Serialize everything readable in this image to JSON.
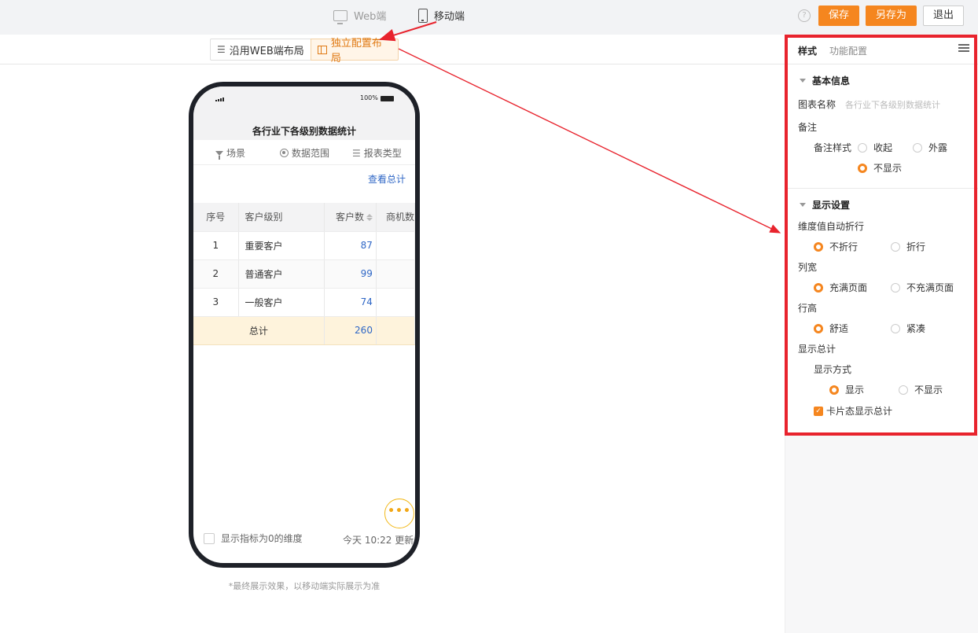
{
  "topbar": {
    "platforms": [
      {
        "label": "Web端",
        "active": false,
        "icon": "monitor-icon"
      },
      {
        "label": "移动端",
        "active": true,
        "icon": "phone-icon"
      }
    ],
    "help_glyph": "?",
    "buttons": {
      "save": "保存",
      "save_as": "另存为",
      "exit": "退出"
    }
  },
  "layout_toggle": {
    "inherit_label": "沿用WEB端布局",
    "independent_label": "独立配置布局",
    "selected": "independent"
  },
  "phone": {
    "battery": "100%",
    "title": "各行业下各级别数据统计",
    "filters": [
      {
        "label": "场景",
        "icon": "funnel-icon"
      },
      {
        "label": "数据范围",
        "icon": "target-icon"
      },
      {
        "label": "报表类型",
        "icon": "list-icon"
      }
    ],
    "view_total": "查看总计",
    "table": {
      "headers": [
        "序号",
        "客户级别",
        "客户数",
        "商机数"
      ],
      "rows": [
        {
          "idx": "1",
          "level": "重要客户",
          "count": "87"
        },
        {
          "idx": "2",
          "level": "普通客户",
          "count": "99"
        },
        {
          "idx": "3",
          "level": "一般客户",
          "count": "74"
        }
      ],
      "total": {
        "label": "总计",
        "count": "260"
      }
    },
    "more_glyph": "•••",
    "zero_dimension_label": "显示指标为0的维度",
    "updated_text": "今天 10:22 更新"
  },
  "disclaimer": "*最终展示效果，以移动端实际展示为准",
  "panel": {
    "tabs": [
      "样式",
      "功能配置"
    ],
    "basic_info": {
      "title": "基本信息",
      "chart_name_label": "图表名称",
      "chart_name_placeholder": "各行业下各级别数据统计",
      "remark_label": "备注",
      "remark_style_label": "备注样式",
      "remark_options": [
        "收起",
        "外露",
        "不显示"
      ],
      "remark_selected": "不显示"
    },
    "display": {
      "title": "显示设置",
      "wrap_label": "维度值自动折行",
      "wrap_options": [
        "不折行",
        "折行"
      ],
      "width_label": "列宽",
      "width_options": [
        "充满页面",
        "不充满页面"
      ],
      "height_label": "行高",
      "height_options": [
        "舒适",
        "紧凑"
      ],
      "total_label": "显示总计",
      "mode_label": "显示方式",
      "mode_options": [
        "显示",
        "不显示"
      ],
      "card_total_label": "卡片态显示总计",
      "card_total_checked": true
    }
  },
  "colors": {
    "accent": "#f5861f",
    "link": "#2f67c6",
    "annotation": "#e8232d"
  }
}
